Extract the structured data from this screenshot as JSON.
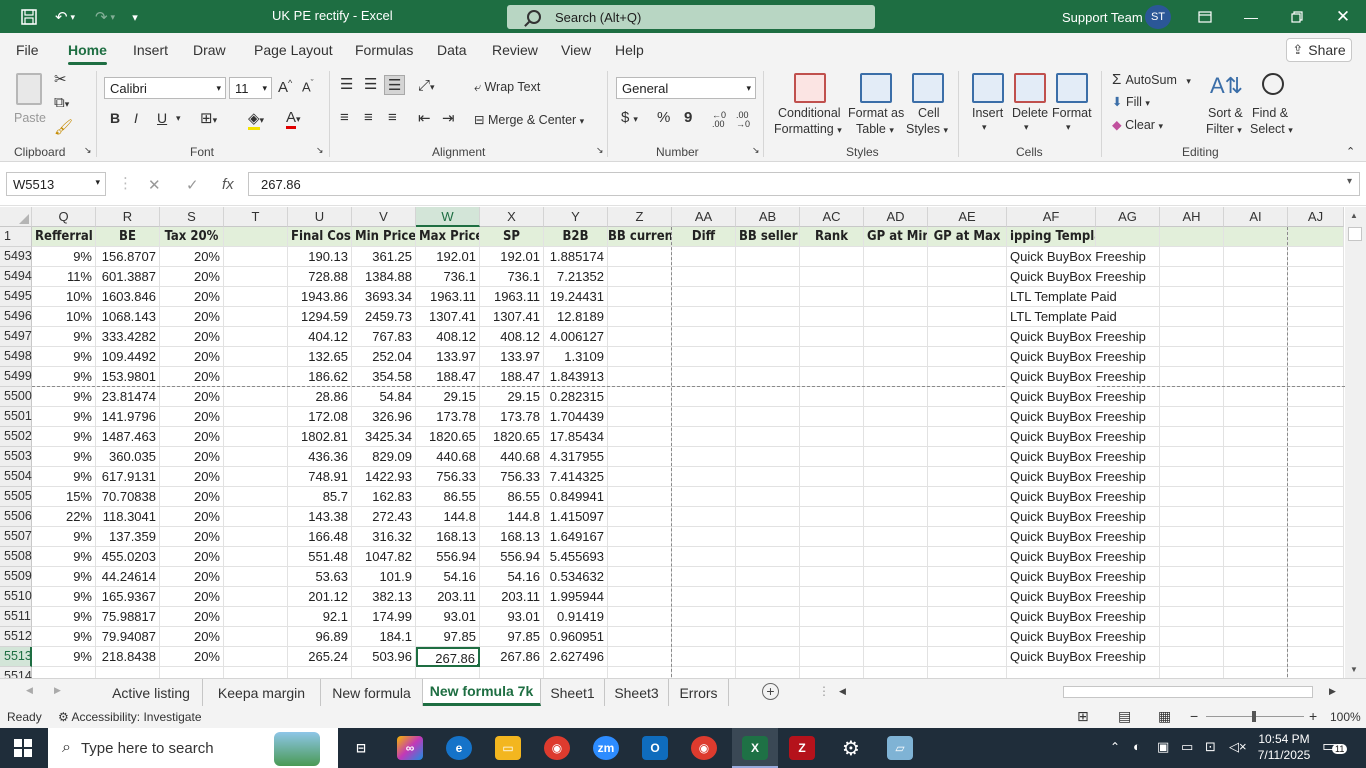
{
  "window": {
    "doc_title": "UK PE rectify  -  Excel",
    "search_placeholder": "Search (Alt+Q)",
    "user_name": "Support Team",
    "user_initials": "ST"
  },
  "ribbon_tabs": [
    "File",
    "Home",
    "Insert",
    "Draw",
    "Page Layout",
    "Formulas",
    "Data",
    "Review",
    "View",
    "Help"
  ],
  "active_ribbon_tab": "Home",
  "share_label": "Share",
  "ribbon": {
    "clipboard": {
      "label": "Clipboard",
      "paste": "Paste"
    },
    "font": {
      "label": "Font",
      "name": "Calibri",
      "size": "11",
      "bold": "B",
      "italic": "I",
      "underline": "U",
      "grow": "A^",
      "shrink": "Aˇ",
      "font_color": "A"
    },
    "alignment": {
      "label": "Alignment",
      "wrap_text": "Wrap Text",
      "merge_center": "Merge & Center"
    },
    "number": {
      "label": "Number",
      "format": "General",
      "currency": "$",
      "percent": "%",
      "comma": "9",
      "inc_decimal": "←0 .00",
      "dec_decimal": ".00 →0"
    },
    "styles": {
      "label": "Styles",
      "conditional_1": "Conditional",
      "conditional_2": "Formatting",
      "format_table_1": "Format as",
      "format_table_2": "Table",
      "cell_styles_1": "Cell",
      "cell_styles_2": "Styles"
    },
    "cells": {
      "label": "Cells",
      "insert": "Insert",
      "delete": "Delete",
      "format": "Format"
    },
    "editing": {
      "label": "Editing",
      "autosum": "AutoSum",
      "fill": "Fill",
      "clear": "Clear",
      "sort_1": "Sort &",
      "sort_2": "Filter",
      "find_1": "Find &",
      "find_2": "Select"
    }
  },
  "formula_bar": {
    "name_box": "W5513",
    "cancel": "✕",
    "enter": "✓",
    "fx": "fx",
    "value": "267.86"
  },
  "columns": [
    "Q",
    "R",
    "S",
    "T",
    "U",
    "V",
    "W",
    "X",
    "Y",
    "Z",
    "AA",
    "AB",
    "AC",
    "AD",
    "AE",
    "AF",
    "AG",
    "AH",
    "AI",
    "AJ"
  ],
  "selected_column": "W",
  "header_row_number": "1",
  "headers": [
    "Refferral",
    "BE",
    "Tax 20%",
    "",
    "Final Cost",
    "Min Price",
    "Max Price",
    "SP",
    "B2B",
    "BB current",
    "Diff",
    "BB seller",
    "Rank",
    "GP at Min",
    "GP at Max",
    "ipping Template",
    "",
    "",
    "",
    ""
  ],
  "rows": [
    {
      "num": "5493",
      "cells": [
        "9%",
        "156.8707",
        "20%",
        "",
        "190.13",
        "361.25",
        "192.01",
        "192.01",
        "1.885174",
        "",
        "",
        "",
        "",
        "",
        "",
        "Quick BuyBox Freeship"
      ]
    },
    {
      "num": "5494",
      "cells": [
        "11%",
        "601.3887",
        "20%",
        "",
        "728.88",
        "1384.88",
        "736.1",
        "736.1",
        "7.21352",
        "",
        "",
        "",
        "",
        "",
        "",
        "Quick BuyBox Freeship"
      ]
    },
    {
      "num": "5495",
      "cells": [
        "10%",
        "1603.846",
        "20%",
        "",
        "1943.86",
        "3693.34",
        "1963.11",
        "1963.11",
        "19.24431",
        "",
        "",
        "",
        "",
        "",
        "",
        "LTL Template Paid"
      ]
    },
    {
      "num": "5496",
      "cells": [
        "10%",
        "1068.143",
        "20%",
        "",
        "1294.59",
        "2459.73",
        "1307.41",
        "1307.41",
        "12.8189",
        "",
        "",
        "",
        "",
        "",
        "",
        "LTL Template Paid"
      ]
    },
    {
      "num": "5497",
      "cells": [
        "9%",
        "333.4282",
        "20%",
        "",
        "404.12",
        "767.83",
        "408.12",
        "408.12",
        "4.006127",
        "",
        "",
        "",
        "",
        "",
        "",
        "Quick BuyBox Freeship"
      ]
    },
    {
      "num": "5498",
      "cells": [
        "9%",
        "109.4492",
        "20%",
        "",
        "132.65",
        "252.04",
        "133.97",
        "133.97",
        "1.3109",
        "",
        "",
        "",
        "",
        "",
        "",
        "Quick BuyBox Freeship"
      ]
    },
    {
      "num": "5499",
      "cells": [
        "9%",
        "153.9801",
        "20%",
        "",
        "186.62",
        "354.58",
        "188.47",
        "188.47",
        "1.843913",
        "",
        "",
        "",
        "",
        "",
        "",
        "Quick BuyBox Freeship"
      ]
    },
    {
      "num": "5500",
      "cells": [
        "9%",
        "23.81474",
        "20%",
        "",
        "28.86",
        "54.84",
        "29.15",
        "29.15",
        "0.282315",
        "",
        "",
        "",
        "",
        "",
        "",
        "Quick BuyBox Freeship"
      ]
    },
    {
      "num": "5501",
      "cells": [
        "9%",
        "141.9796",
        "20%",
        "",
        "172.08",
        "326.96",
        "173.78",
        "173.78",
        "1.704439",
        "",
        "",
        "",
        "",
        "",
        "",
        "Quick BuyBox Freeship"
      ]
    },
    {
      "num": "5502",
      "cells": [
        "9%",
        "1487.463",
        "20%",
        "",
        "1802.81",
        "3425.34",
        "1820.65",
        "1820.65",
        "17.85434",
        "",
        "",
        "",
        "",
        "",
        "",
        "Quick BuyBox Freeship"
      ]
    },
    {
      "num": "5503",
      "cells": [
        "9%",
        "360.035",
        "20%",
        "",
        "436.36",
        "829.09",
        "440.68",
        "440.68",
        "4.317955",
        "",
        "",
        "",
        "",
        "",
        "",
        "Quick BuyBox Freeship"
      ]
    },
    {
      "num": "5504",
      "cells": [
        "9%",
        "617.9131",
        "20%",
        "",
        "748.91",
        "1422.93",
        "756.33",
        "756.33",
        "7.414325",
        "",
        "",
        "",
        "",
        "",
        "",
        "Quick BuyBox Freeship"
      ]
    },
    {
      "num": "5505",
      "cells": [
        "15%",
        "70.70838",
        "20%",
        "",
        "85.7",
        "162.83",
        "86.55",
        "86.55",
        "0.849941",
        "",
        "",
        "",
        "",
        "",
        "",
        "Quick BuyBox Freeship"
      ]
    },
    {
      "num": "5506",
      "cells": [
        "22%",
        "118.3041",
        "20%",
        "",
        "143.38",
        "272.43",
        "144.8",
        "144.8",
        "1.415097",
        "",
        "",
        "",
        "",
        "",
        "",
        "Quick BuyBox Freeship"
      ]
    },
    {
      "num": "5507",
      "cells": [
        "9%",
        "137.359",
        "20%",
        "",
        "166.48",
        "316.32",
        "168.13",
        "168.13",
        "1.649167",
        "",
        "",
        "",
        "",
        "",
        "",
        "Quick BuyBox Freeship"
      ]
    },
    {
      "num": "5508",
      "cells": [
        "9%",
        "455.0203",
        "20%",
        "",
        "551.48",
        "1047.82",
        "556.94",
        "556.94",
        "5.455693",
        "",
        "",
        "",
        "",
        "",
        "",
        "Quick BuyBox Freeship"
      ]
    },
    {
      "num": "5509",
      "cells": [
        "9%",
        "44.24614",
        "20%",
        "",
        "53.63",
        "101.9",
        "54.16",
        "54.16",
        "0.534632",
        "",
        "",
        "",
        "",
        "",
        "",
        "Quick BuyBox Freeship"
      ]
    },
    {
      "num": "5510",
      "cells": [
        "9%",
        "165.9367",
        "20%",
        "",
        "201.12",
        "382.13",
        "203.11",
        "203.11",
        "1.995944",
        "",
        "",
        "",
        "",
        "",
        "",
        "Quick BuyBox Freeship"
      ]
    },
    {
      "num": "5511",
      "cells": [
        "9%",
        "75.98817",
        "20%",
        "",
        "92.1",
        "174.99",
        "93.01",
        "93.01",
        "0.91419",
        "",
        "",
        "",
        "",
        "",
        "",
        "Quick BuyBox Freeship"
      ]
    },
    {
      "num": "5512",
      "cells": [
        "9%",
        "79.94087",
        "20%",
        "",
        "96.89",
        "184.1",
        "97.85",
        "97.85",
        "0.960951",
        "",
        "",
        "",
        "",
        "",
        "",
        "Quick BuyBox Freeship"
      ]
    },
    {
      "num": "5513",
      "cells": [
        "9%",
        "218.8438",
        "20%",
        "",
        "265.24",
        "503.96",
        "267.86",
        "267.86",
        "2.627496",
        "",
        "",
        "",
        "",
        "",
        "",
        "Quick BuyBox Freeship"
      ]
    },
    {
      "num": "5514",
      "cells": [
        "",
        "",
        "",
        "",
        "",
        "",
        "",
        "",
        "",
        "",
        "",
        "",
        "",
        "",
        "",
        ""
      ]
    }
  ],
  "active_cell": {
    "row": "5513",
    "col": "W"
  },
  "sheet_tabs": [
    "Active listing",
    "Keepa margin",
    "New formula",
    "New formula 7k",
    "Sheet1",
    "Sheet3",
    "Errors"
  ],
  "active_sheet": "New formula 7k",
  "status": {
    "ready": "Ready",
    "accessibility": "Accessibility: Investigate",
    "zoom": "100%"
  },
  "taskbar": {
    "search_placeholder": "Type here to search",
    "time": "10:54 PM",
    "date": "7/11/2025",
    "notifications": "11"
  }
}
